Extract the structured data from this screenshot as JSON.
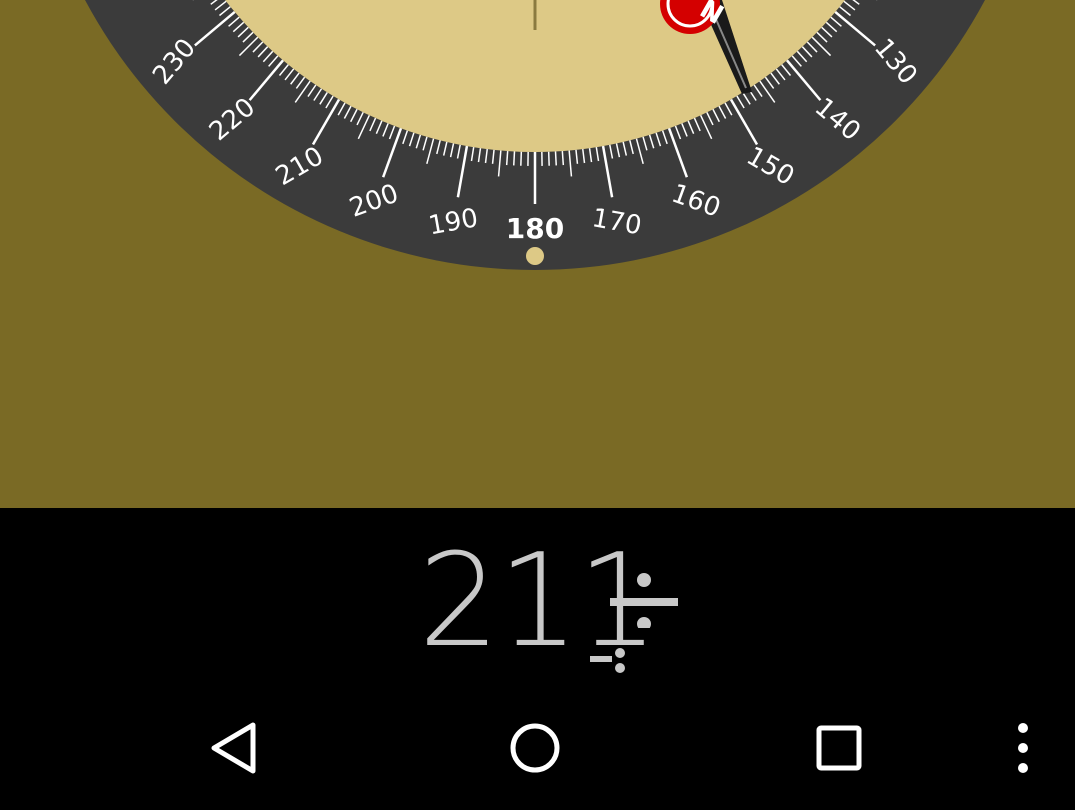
{
  "compass": {
    "heading": "211",
    "heading_unit_icon": "heading-divider-icon",
    "visible_degree_labels": [
      "230",
      "220",
      "210",
      "200",
      "190",
      "180",
      "170",
      "160",
      "150",
      "140",
      "130"
    ],
    "highlighted_label": "180",
    "needle_marker_letter": "N",
    "colors": {
      "background": "#7a6a25",
      "dial_ring": "#3b3b3b",
      "dial_face": "#ddc986",
      "needle_red": "#d40000",
      "readout_text": "#c8c8c8"
    }
  },
  "navigation": {
    "back_icon": "back-triangle-icon",
    "home_icon": "home-circle-icon",
    "recents_icon": "recents-square-icon",
    "menu_icon": "overflow-menu-icon"
  }
}
